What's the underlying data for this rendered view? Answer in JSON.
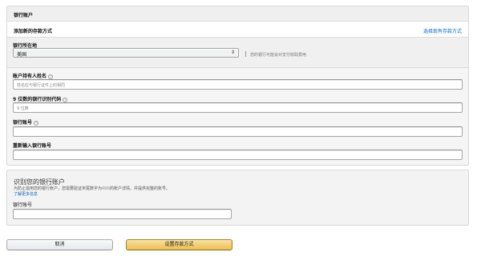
{
  "header": {
    "title": "银行账户"
  },
  "subheader": {
    "title": "添加新的存款方式",
    "existing_link": "选择现有存款方式"
  },
  "country": {
    "label": "银行所在地",
    "value": "美国",
    "note": "您的银行可能会对支付收取费用"
  },
  "fields": {
    "holder_name": {
      "label": "账户持有人姓名",
      "placeholder": "姓名应与银行证件上的相同"
    },
    "routing": {
      "label": "9 位数的银行识别代码",
      "placeholder": "9 位数"
    },
    "account": {
      "label": "银行账号",
      "placeholder": ""
    },
    "account_confirm": {
      "label": "重新输入银行账号",
      "placeholder": ""
    }
  },
  "identify": {
    "title": "识别您的银行账户",
    "desc_before": "为防止滥用您的银行账户，您需要验证末尾数字为",
    "desc_after": "的账户详情，并提供完整的账号。",
    "learn_more": "了解更多信息",
    "account_label": "银行账号",
    "account_placeholder": ""
  },
  "buttons": {
    "cancel": "取消",
    "set": "设置存款方式"
  },
  "colors": {
    "link": "#0066c0",
    "primary_button": "#f0c14b"
  }
}
